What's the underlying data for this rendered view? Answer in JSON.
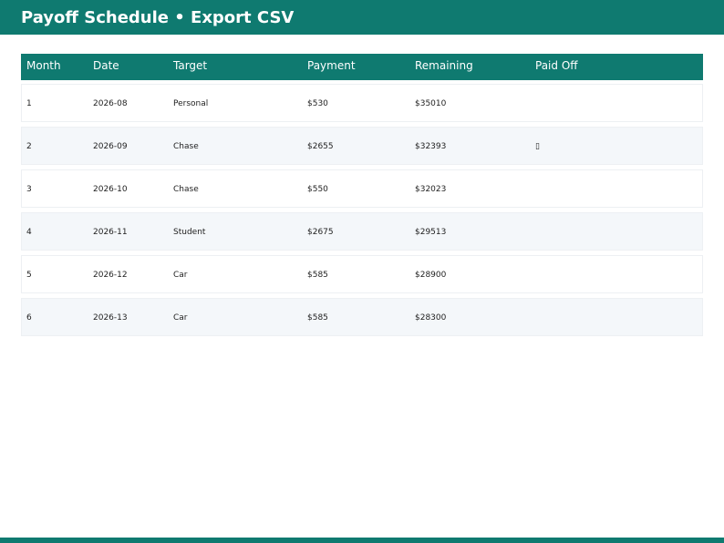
{
  "header": {
    "title": "Payoff Schedule • Export CSV"
  },
  "table": {
    "columns": [
      "Month",
      "Date",
      "Target",
      "Payment",
      "Remaining",
      "Paid Off"
    ],
    "rows": [
      {
        "month": "1",
        "date": "2026-08",
        "target": "Personal",
        "payment": "$530",
        "remaining": "$35010",
        "paid_off": ""
      },
      {
        "month": "2",
        "date": "2026-09",
        "target": "Chase",
        "payment": "$2655",
        "remaining": "$32393",
        "paid_off": "▯"
      },
      {
        "month": "3",
        "date": "2026-10",
        "target": "Chase",
        "payment": "$550",
        "remaining": "$32023",
        "paid_off": ""
      },
      {
        "month": "4",
        "date": "2026-11",
        "target": "Student",
        "payment": "$2675",
        "remaining": "$29513",
        "paid_off": ""
      },
      {
        "month": "5",
        "date": "2026-12",
        "target": "Car",
        "payment": "$585",
        "remaining": "$28900",
        "paid_off": ""
      },
      {
        "month": "6",
        "date": "2026-13",
        "target": "Car",
        "payment": "$585",
        "remaining": "$28300",
        "paid_off": ""
      }
    ]
  },
  "colors": {
    "accent": "#0f7a70",
    "row_alt": "#f4f7fa",
    "row_border": "#edf0f3"
  }
}
